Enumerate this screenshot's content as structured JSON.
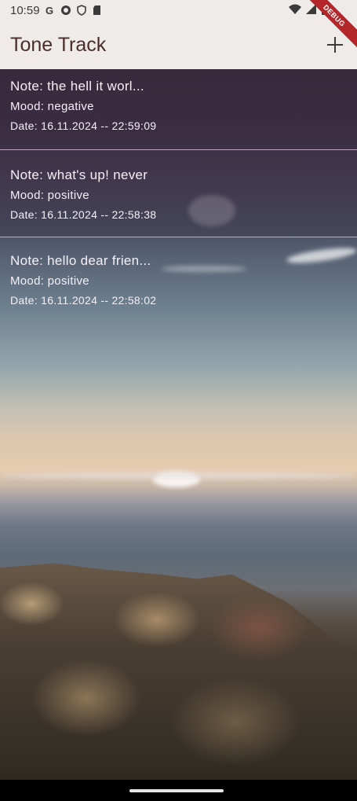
{
  "status_bar": {
    "time": "10:59"
  },
  "app_bar": {
    "title": "Tone Track"
  },
  "debug_banner": {
    "label": "DEBUG"
  },
  "notes": [
    {
      "note": "Note: the hell it worl...",
      "mood": "Mood: negative",
      "date": "Date: 16.11.2024 -- 22:59:09"
    },
    {
      "note": "Note: what's up! never",
      "mood": "Mood: positive",
      "date": "Date: 16.11.2024 -- 22:58:38"
    },
    {
      "note": "Note: hello dear frien...",
      "mood": "Mood: positive",
      "date": "Date: 16.11.2024 -- 22:58:02"
    }
  ],
  "icons": {
    "status_left": [
      "google-icon",
      "sync-icon",
      "shield-icon",
      "sd-card-icon"
    ],
    "status_right": [
      "wifi-icon",
      "signal-icon",
      "battery-icon"
    ],
    "add": "add-icon"
  },
  "colors": {
    "app_bar_bg": "#efebe8",
    "title_color": "#4a2d2a",
    "divider": "#c4a7c6",
    "debug_banner": "#b3262a"
  }
}
